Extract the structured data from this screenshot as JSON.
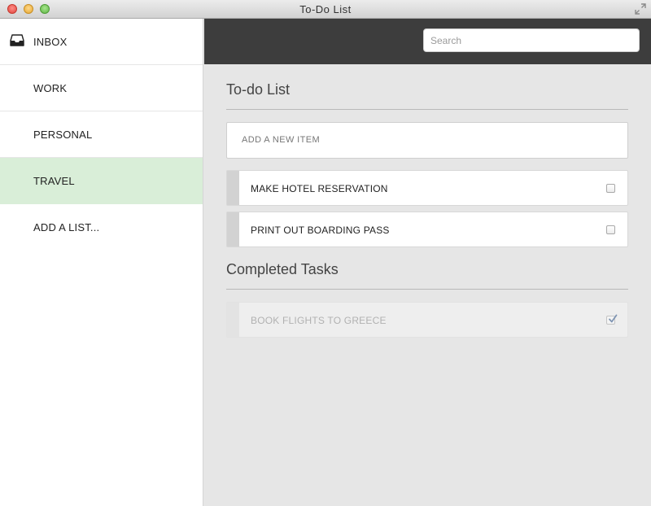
{
  "window": {
    "title": "To-Do List"
  },
  "sidebar": {
    "items": [
      {
        "label": "INBOX",
        "icon": "inbox-icon"
      },
      {
        "label": "WORK"
      },
      {
        "label": "PERSONAL"
      },
      {
        "label": "TRAVEL",
        "selected": true
      },
      {
        "label": "ADD A LIST..."
      }
    ]
  },
  "header": {
    "search_placeholder": "Search",
    "search_value": ""
  },
  "todo": {
    "title": "To-do List",
    "add_placeholder": "ADD A NEW ITEM",
    "tasks": [
      {
        "label": "MAKE HOTEL RESERVATION",
        "checked": false
      },
      {
        "label": "PRINT OUT BOARDING PASS",
        "checked": false
      }
    ]
  },
  "completed": {
    "title": "Completed Tasks",
    "tasks": [
      {
        "label": "BOOK FLIGHTS TO GREECE",
        "checked": true
      }
    ]
  },
  "colors": {
    "selected_list": "#d9eed8",
    "header_bar": "#3d3d3d",
    "content_bg": "#e6e6e6"
  }
}
